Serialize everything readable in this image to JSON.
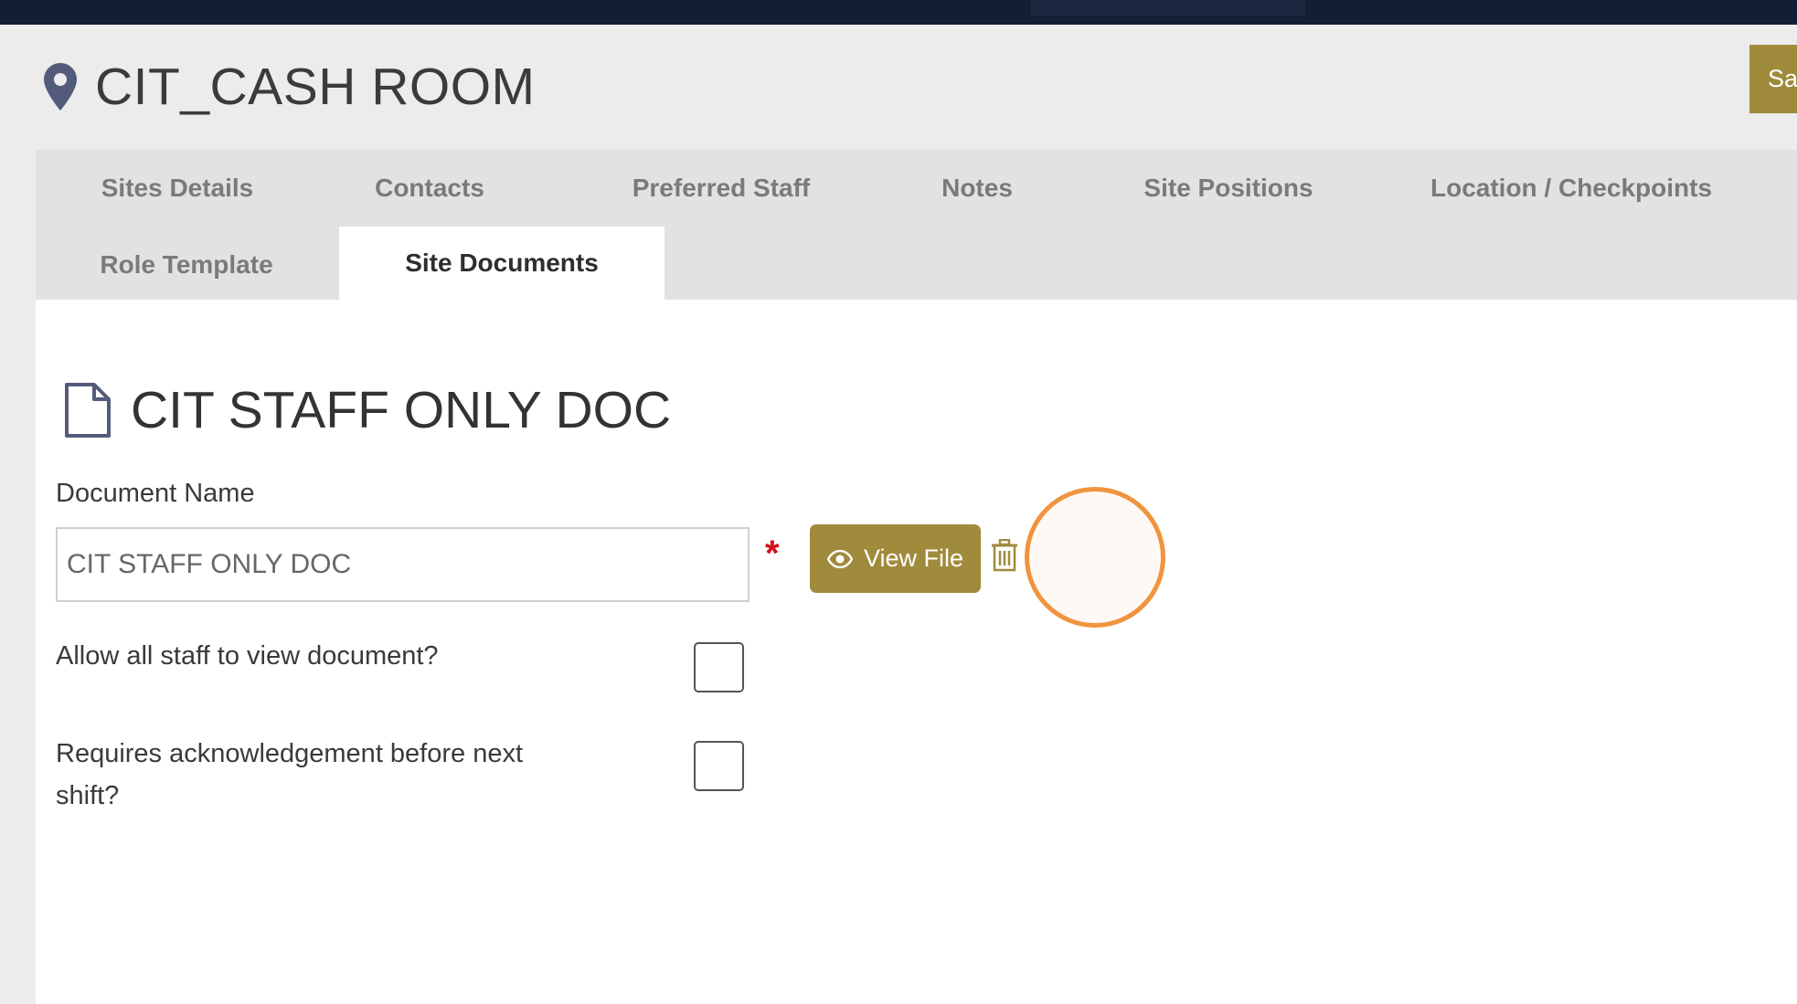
{
  "header": {
    "title": "CIT_CASH ROOM",
    "save_label": "Sa"
  },
  "tabs": [
    {
      "label": "Sites Details",
      "active": false
    },
    {
      "label": "Contacts",
      "active": false
    },
    {
      "label": "Preferred Staff",
      "active": false
    },
    {
      "label": "Notes",
      "active": false
    },
    {
      "label": "Site Positions",
      "active": false
    },
    {
      "label": "Location / Checkpoints",
      "active": false
    },
    {
      "label": "Role Template",
      "active": false
    },
    {
      "label": "Site Documents",
      "active": true
    }
  ],
  "document": {
    "heading": "CIT STAFF ONLY DOC",
    "name_label": "Document Name",
    "name_value": "CIT STAFF ONLY DOC",
    "required_mark": "*",
    "view_file_label": "View File",
    "allow_all_label": "Allow all staff to view document?",
    "allow_all_checked": false,
    "requires_ack_label": "Requires acknowledgement before next shift?",
    "requires_ack_checked": false
  },
  "icons": {
    "location": "map-pin-icon",
    "document": "file-icon",
    "view": "eye-icon",
    "delete": "trash-icon"
  },
  "colors": {
    "accent": "#a08a3c",
    "topbar": "#141e33",
    "required": "#d4101b",
    "click_highlight": "#f0943e"
  }
}
